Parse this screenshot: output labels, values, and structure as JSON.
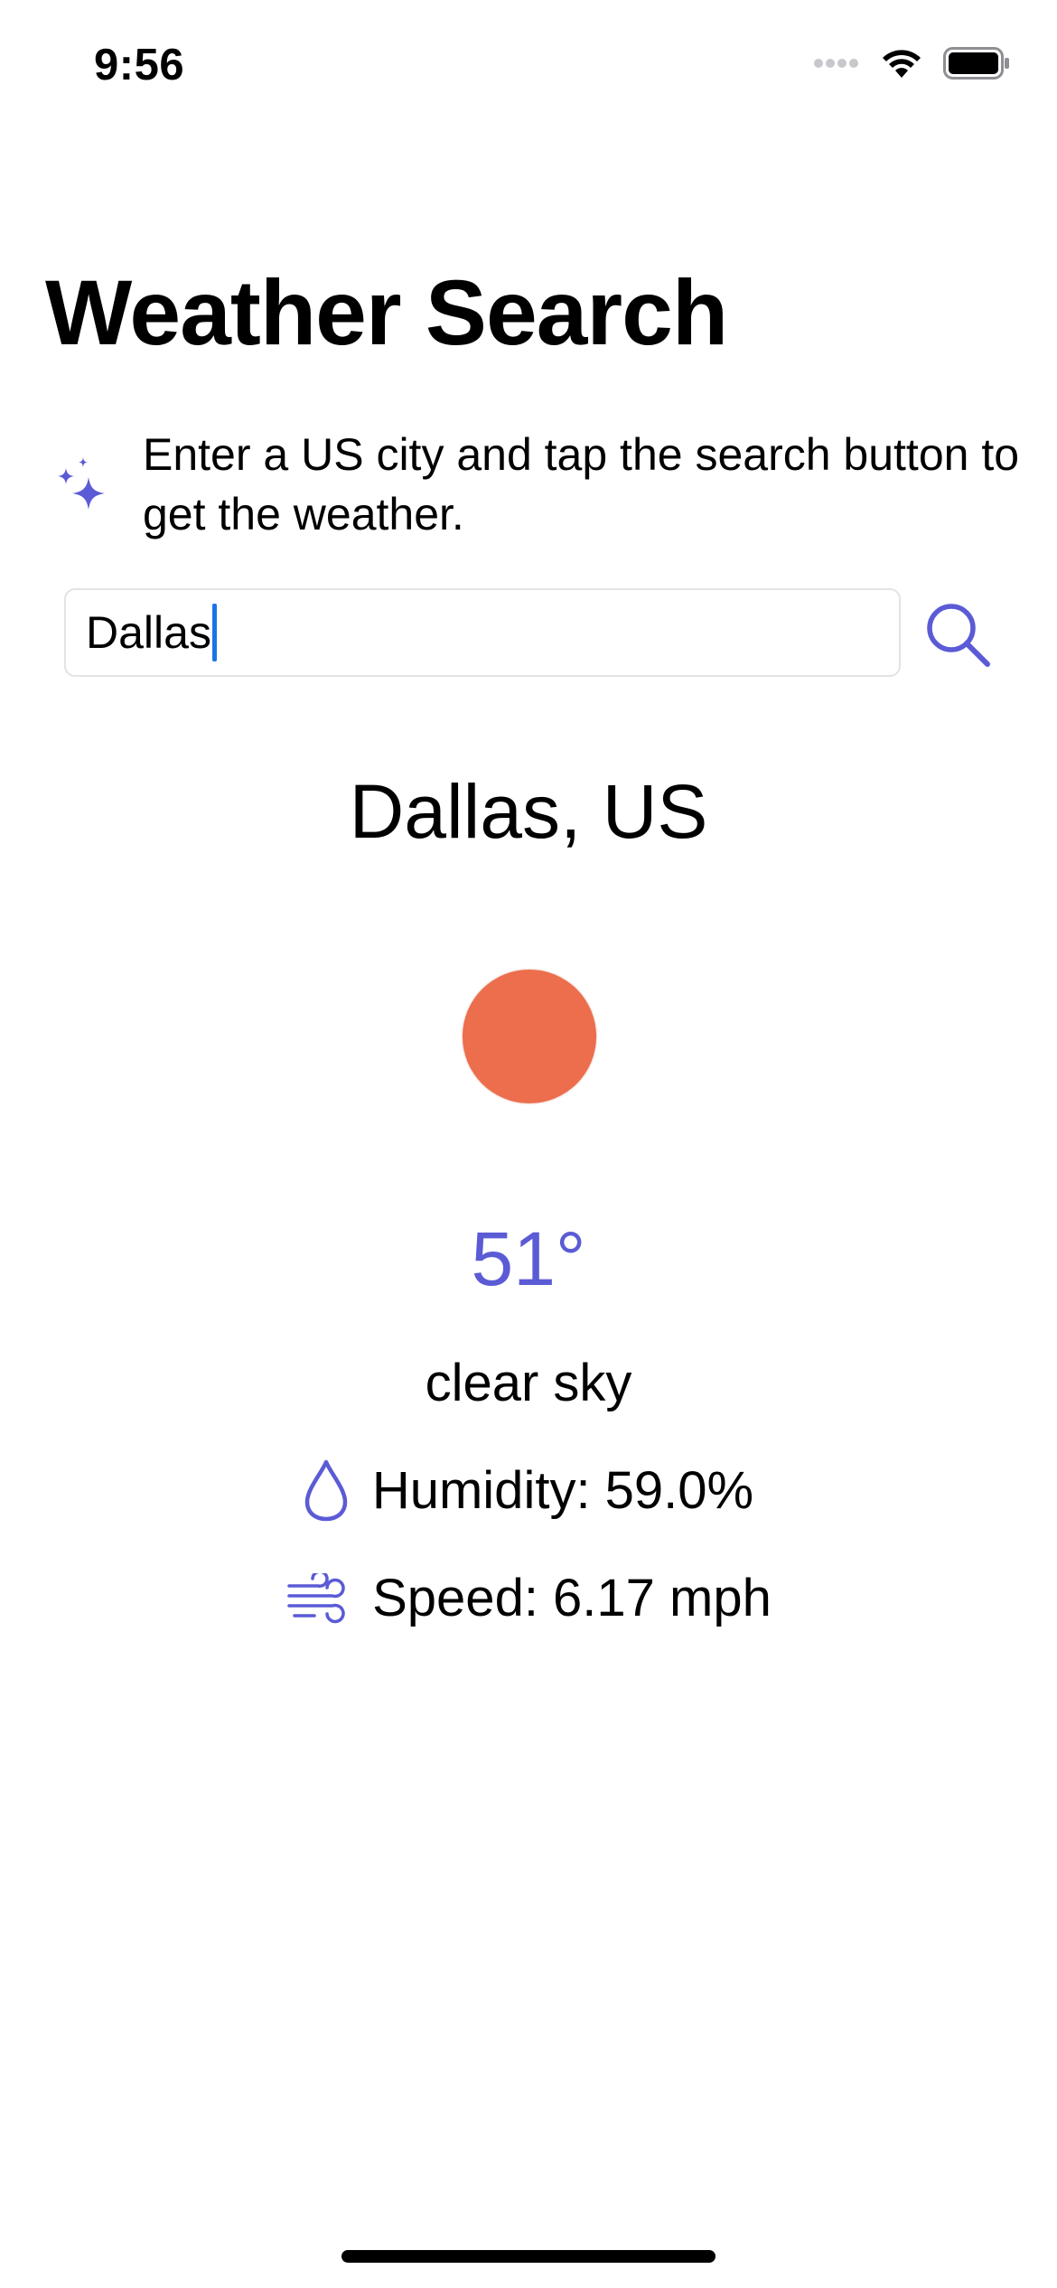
{
  "status_bar": {
    "time": "9:56",
    "icons": [
      "signal-icon",
      "wifi-icon",
      "battery-icon"
    ]
  },
  "header": {
    "title": "Weather Search"
  },
  "hint": {
    "icon": "sparkles-icon",
    "text": "Enter a US city and tap the search button to get the weather."
  },
  "search": {
    "value": "Dallas",
    "button_icon": "magnifying-glass-icon"
  },
  "result": {
    "city": "Dallas, US",
    "condition_icon": "sun-circle-icon",
    "temperature": "51°",
    "description": "clear sky",
    "humidity": "Humidity: 59.0%",
    "speed": "Speed: 6.17 mph"
  },
  "colors": {
    "accent": "#5b5bd6",
    "sun": "#ec6e4c",
    "caret": "#1a73e8",
    "field_border": "#e3e3e6"
  }
}
